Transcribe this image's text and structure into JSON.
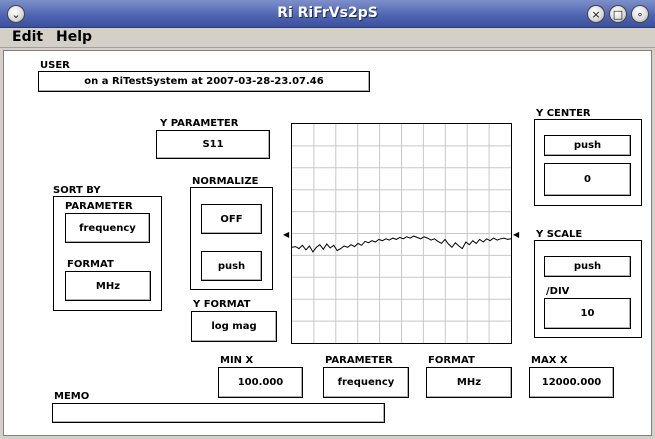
{
  "window": {
    "title": "Ri RiFrVs2pS"
  },
  "menu": {
    "edit": "Edit",
    "help": "Help"
  },
  "user": {
    "label": "USER",
    "value": "on a RiTestSystem at 2007-03-28-23.07.46"
  },
  "y_parameter": {
    "label": "Y PARAMETER",
    "value": "S11"
  },
  "sort_by": {
    "label": "SORT BY",
    "parameter_label": "PARAMETER",
    "parameter_value": "frequency",
    "format_label": "FORMAT",
    "format_value": "MHz"
  },
  "normalize": {
    "label": "NORMALIZE",
    "off_button": "OFF",
    "push_button": "push"
  },
  "y_format": {
    "label": "Y FORMAT",
    "value": "log mag"
  },
  "y_center": {
    "label": "Y CENTER",
    "push_button": "push",
    "value": "0"
  },
  "y_scale": {
    "label": "Y SCALE",
    "push_button": "push",
    "div_label": "/DIV",
    "value": "10"
  },
  "x_axis": {
    "min_label": "MIN X",
    "min_value": "100.000",
    "parameter_label": "PARAMETER",
    "parameter_value": "frequency",
    "format_label": "FORMAT",
    "format_value": "MHz",
    "max_label": "MAX X",
    "max_value": "12000.000"
  },
  "memo": {
    "label": "MEMO",
    "value": ""
  },
  "chart_data": {
    "type": "line",
    "grid": true,
    "x_divisions": 10,
    "y_divisions": 10,
    "ref_level": 0,
    "scale_per_div": 10,
    "series": [
      {
        "values": [
          -6.3,
          -6.0,
          -6.9,
          -5.4,
          -7.5,
          -5.7,
          -8.4,
          -6.3,
          -5.1,
          -7.2,
          -4.8,
          -6.6,
          -5.4,
          -7.8,
          -6.9,
          -5.7,
          -6.3,
          -5.1,
          -6.0,
          -4.5,
          -5.4,
          -3.6,
          -4.2,
          -3.3,
          -3.9,
          -2.7,
          -3.3,
          -2.4,
          -3.0,
          -2.1,
          -2.7,
          -1.8,
          -2.4,
          -1.5,
          -2.1,
          -1.2,
          -1.8,
          -2.4,
          -1.5,
          -2.1,
          -3.0,
          -2.4,
          -3.6,
          -4.5,
          -2.7,
          -4.8,
          -6.3,
          -4.2,
          -5.7,
          -6.9,
          -3.9,
          -5.1,
          -3.3,
          -4.5,
          -2.7,
          -3.9,
          -2.4,
          -3.3,
          -2.1,
          -3.0,
          -2.4,
          -2.1,
          -2.7,
          -2.4
        ]
      }
    ]
  }
}
